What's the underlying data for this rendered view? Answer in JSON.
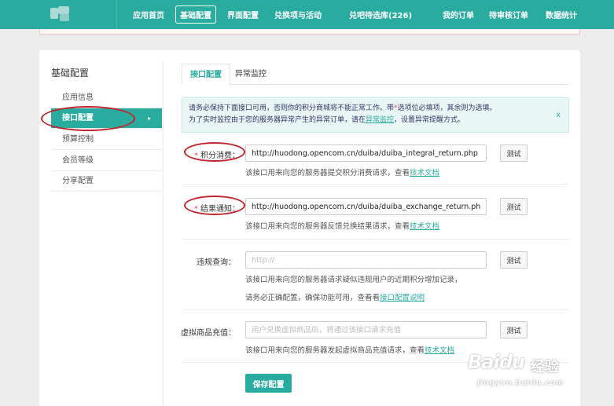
{
  "nav": {
    "items": [
      {
        "label": "应用首页"
      },
      {
        "label": "基础配置"
      },
      {
        "label": "界面配置"
      },
      {
        "label": "兑换项与活动"
      },
      {
        "label": "兑吧待选库(226)"
      },
      {
        "label": "我的订单"
      },
      {
        "label": "待审核订单"
      },
      {
        "label": "数据统计"
      }
    ],
    "active_index": 1
  },
  "sidebar": {
    "title": "基础配置",
    "items": [
      {
        "label": "应用信息"
      },
      {
        "label": "接口配置"
      },
      {
        "label": "预算控制"
      },
      {
        "label": "会员等级"
      },
      {
        "label": "分享配置"
      }
    ],
    "active_index": 1,
    "active_arrow": "▸"
  },
  "tabs": [
    {
      "label": "接口配置"
    },
    {
      "label": "异常监控"
    }
  ],
  "info": {
    "line1_a": "请务必保持下面接口可用，否则你的积分商城将不能正常工作。带",
    "star": "*",
    "line1_b": "选项位必填项，其余则为选填。",
    "line2_a": "为了实时监控由于您的服务器异常产生的异常订单，请在",
    "line2_link": "异常监控",
    "line2_b": "，设置异常提醒方式。",
    "close": "x"
  },
  "form": {
    "required_mark": "*",
    "rows": [
      {
        "label": "积分消费：",
        "value": "http://huodong.opencom.cn/duiba/duiba_integral_return.php",
        "placeholder": "",
        "hint": "该接口用来向您的服务器提交积分消费请求，查看",
        "hint_link": "技术文档",
        "test": "测试"
      },
      {
        "label": "结果通知：",
        "value": "http://huodong.opencom.cn/duiba/duiba_exchange_return.php",
        "placeholder": "",
        "hint": "该接口用来向您的服务器反馈兑换结果请求，查看",
        "hint_link": "技术文档",
        "test": "测试"
      },
      {
        "label": "违规查询：",
        "value": "",
        "placeholder": "http://",
        "hint": "该接口用来向您的服务器请求疑似违规用户的近期积分增加记录，",
        "hint2": "请务必正确配置，确保功能可用，查看看",
        "hint_link": "接口配置说明",
        "test": "测试"
      },
      {
        "label": "虚拟商品充值：",
        "value": "",
        "placeholder": "用户兑换虚拟商品后，将通过该接口请求充值",
        "hint": "该接口用来向您的服务器发起虚拟商品充值请求，查看",
        "hint_link": "技术文档",
        "test": "测试"
      }
    ],
    "save": "保存配置"
  },
  "watermark": {
    "main": "Bai",
    "paw": "du",
    "sub": "经验",
    "url": "jingyan.baidu.com"
  },
  "colors": {
    "brand": "#2aab9f",
    "annotation": "#c0262b",
    "required": "#e44444"
  }
}
